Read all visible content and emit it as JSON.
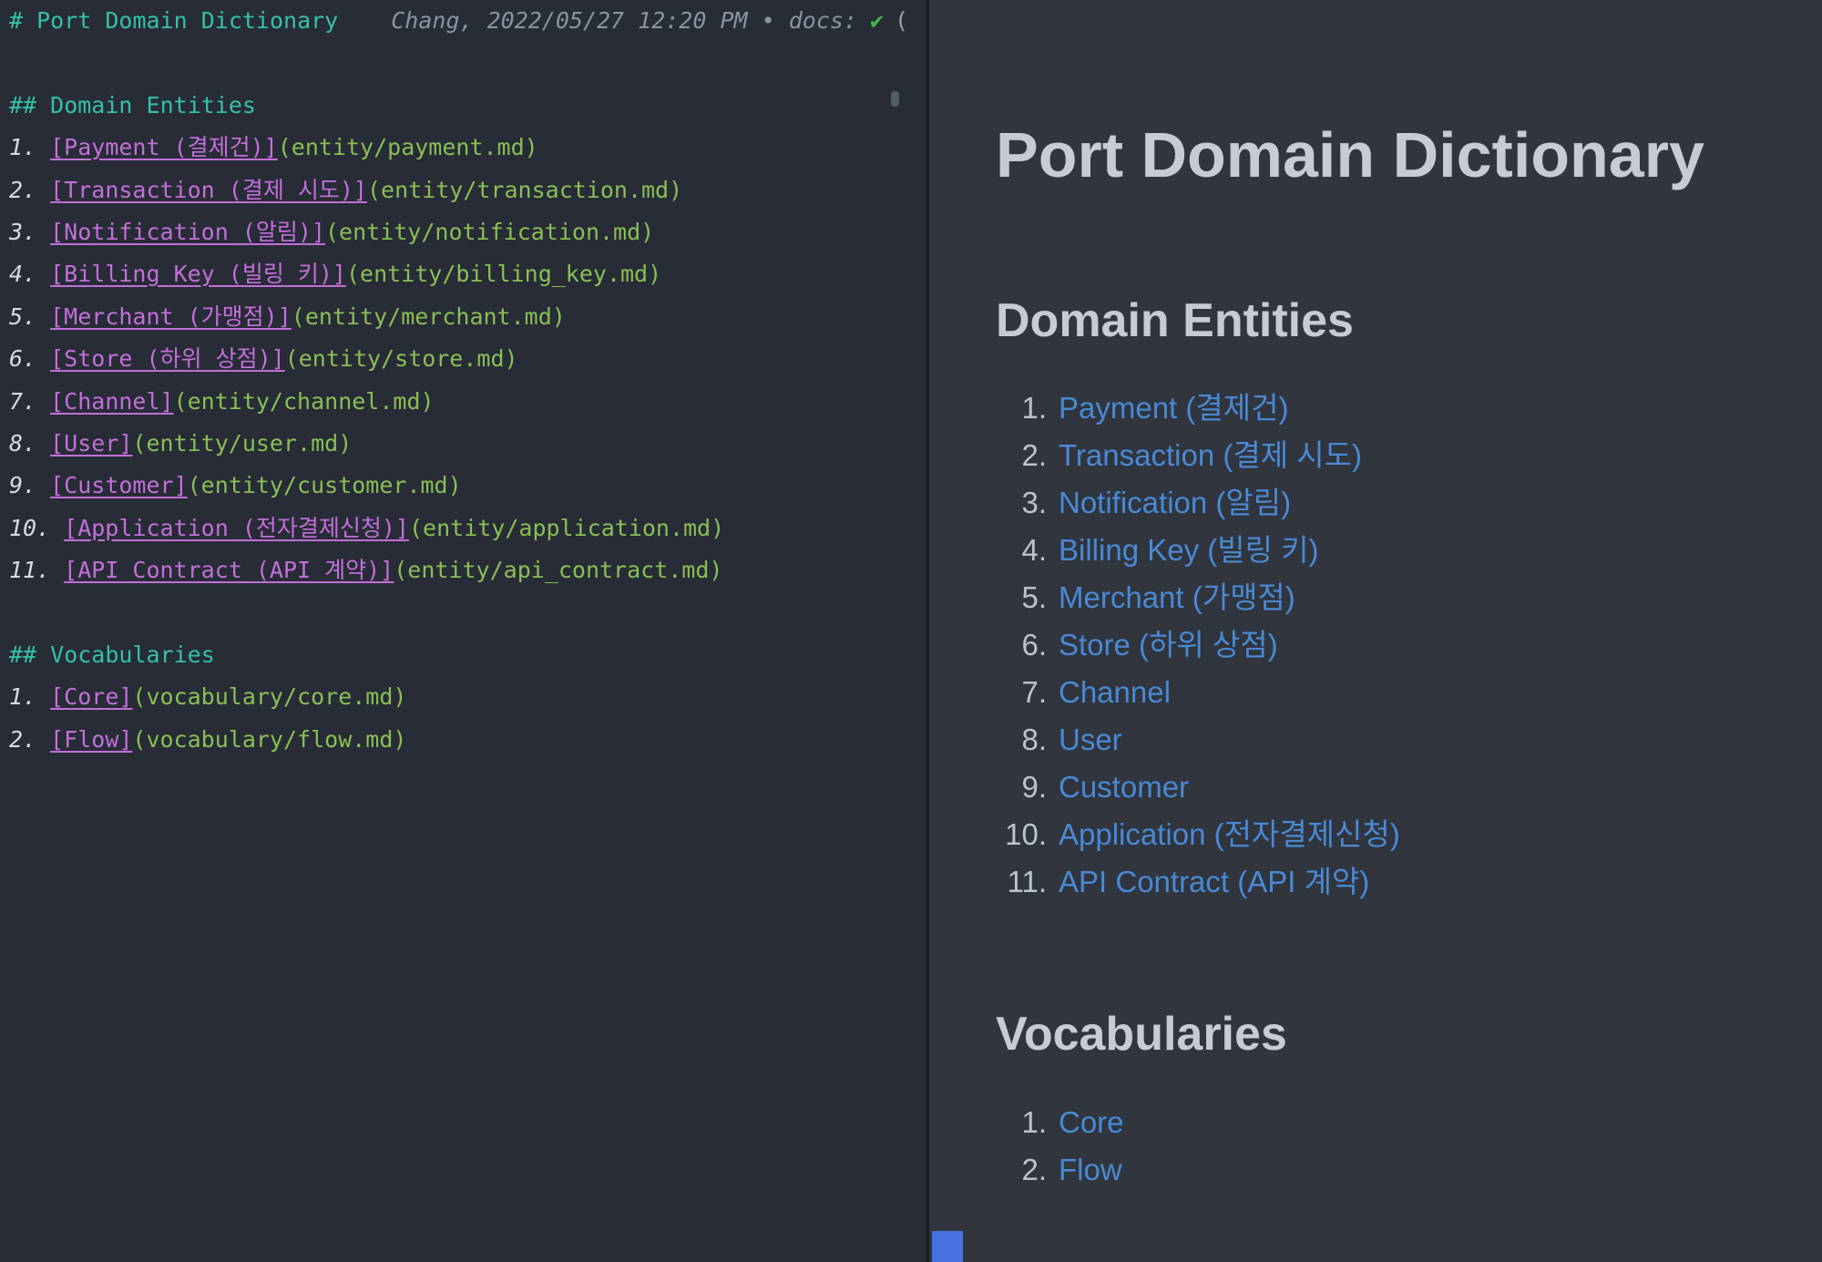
{
  "colors": {
    "editor_bg": "#272c36",
    "preview_bg": "#30353e",
    "editor_text": "#ced4de",
    "heading_teal": "#35c0a8",
    "link_purple": "#c36fd9",
    "url_green": "#8abf55",
    "meta_gray": "#8a93a2",
    "check_green": "#3fb950",
    "preview_text": "#c7ccd4",
    "preview_link": "#4a89d4",
    "list_number": "#bdc3cc",
    "corner_blue": "#4872e0"
  },
  "editor": {
    "title": "# Port Domain Dictionary",
    "meta": "Chang, 2022/05/27 12:20 PM • docs:",
    "check": "✔",
    "clipped": "(",
    "sections": [
      {
        "heading": "## Domain Entities",
        "items": [
          {
            "num": "1.",
            "link": "[Payment (결제건)]",
            "url": "(entity/payment.md)"
          },
          {
            "num": "2.",
            "link": "[Transaction (결제 시도)]",
            "url": "(entity/transaction.md)"
          },
          {
            "num": "3.",
            "link": "[Notification (알림)]",
            "url": "(entity/notification.md)"
          },
          {
            "num": "4.",
            "link": "[Billing Key (빌링 키)]",
            "url": "(entity/billing_key.md)"
          },
          {
            "num": "5.",
            "link": "[Merchant (가맹점)]",
            "url": "(entity/merchant.md)"
          },
          {
            "num": "6.",
            "link": "[Store (하위 상점)]",
            "url": "(entity/store.md)"
          },
          {
            "num": "7.",
            "link": "[Channel]",
            "url": "(entity/channel.md)"
          },
          {
            "num": "8.",
            "link": "[User]",
            "url": "(entity/user.md)"
          },
          {
            "num": "9.",
            "link": "[Customer]",
            "url": "(entity/customer.md)"
          },
          {
            "num": "10.",
            "link": "[Application (전자결제신청)]",
            "url": "(entity/application.md)"
          },
          {
            "num": "11.",
            "link": "[API Contract (API 계약)]",
            "url": "(entity/api_contract.md)"
          }
        ]
      },
      {
        "heading": "## Vocabularies",
        "items": [
          {
            "num": "1.",
            "link": "[Core]",
            "url": "(vocabulary/core.md)"
          },
          {
            "num": "2.",
            "link": "[Flow]",
            "url": "(vocabulary/flow.md)"
          }
        ]
      }
    ]
  },
  "preview": {
    "title": "Port Domain Dictionary",
    "sections": [
      {
        "heading": "Domain Entities",
        "items": [
          {
            "num": "1.",
            "label": "Payment (결제건)"
          },
          {
            "num": "2.",
            "label": "Transaction (결제 시도)"
          },
          {
            "num": "3.",
            "label": "Notification (알림)"
          },
          {
            "num": "4.",
            "label": "Billing Key (빌링 키)"
          },
          {
            "num": "5.",
            "label": "Merchant (가맹점)"
          },
          {
            "num": "6.",
            "label": "Store (하위 상점)"
          },
          {
            "num": "7.",
            "label": "Channel"
          },
          {
            "num": "8.",
            "label": "User"
          },
          {
            "num": "9.",
            "label": "Customer"
          },
          {
            "num": "10.",
            "label": "Application (전자결제신청)"
          },
          {
            "num": "11.",
            "label": "API Contract (API 계약)"
          }
        ]
      },
      {
        "heading": "Vocabularies",
        "items": [
          {
            "num": "1.",
            "label": "Core"
          },
          {
            "num": "2.",
            "label": "Flow"
          }
        ]
      }
    ]
  }
}
